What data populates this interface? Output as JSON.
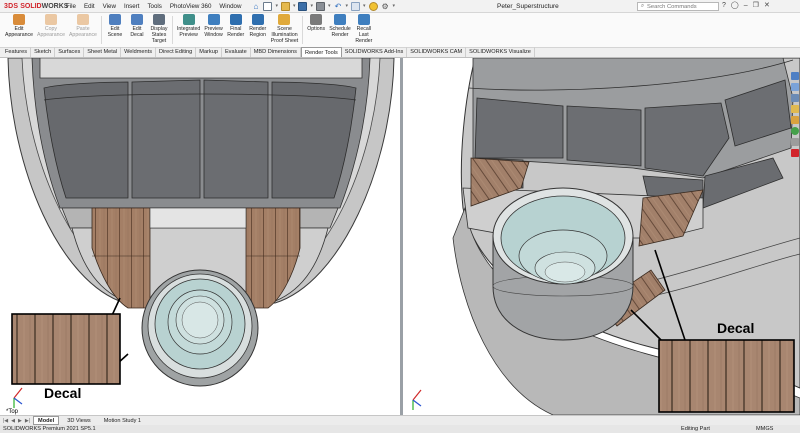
{
  "app": {
    "logo_ds": "3DS",
    "logo_sw": "SOLID",
    "logo_works": "WORKS",
    "document_title": "Peter_Superstructure",
    "menus": [
      "File",
      "Edit",
      "View",
      "Insert",
      "Tools",
      "PhotoView 360",
      "Window"
    ],
    "search_placeholder": "Search Commands"
  },
  "ribbon": {
    "buttons": [
      {
        "label": "Edit\nAppearance",
        "icon": "appearance-icon",
        "disabled": false
      },
      {
        "label": "Copy\nAppearance",
        "icon": "copy-appearance-icon",
        "disabled": true
      },
      {
        "label": "Paste\nAppearance",
        "icon": "paste-appearance-icon",
        "disabled": true
      },
      {
        "label": "Edit\nScene",
        "icon": "scene-icon",
        "disabled": false
      },
      {
        "label": "Edit\nDecal",
        "icon": "decal-icon",
        "disabled": false
      },
      {
        "label": "Display\nStates\nTarget",
        "icon": "display-states-icon",
        "disabled": false
      },
      {
        "label": "Integrated\nPreview",
        "icon": "integrated-preview-icon",
        "disabled": false
      },
      {
        "label": "Preview\nWindow",
        "icon": "preview-window-icon",
        "disabled": false
      },
      {
        "label": "Final\nRender",
        "icon": "final-render-icon",
        "disabled": false
      },
      {
        "label": "Render\nRegion",
        "icon": "render-region-icon",
        "disabled": false
      },
      {
        "label": "Scene\nIllumination\nProof Sheet",
        "icon": "illumination-icon",
        "disabled": false
      },
      {
        "label": "Options",
        "icon": "options-icon",
        "disabled": false
      },
      {
        "label": "Schedule\nRender",
        "icon": "schedule-icon",
        "disabled": false
      },
      {
        "label": "Recall\nLast\nRender",
        "icon": "recall-icon",
        "disabled": false
      }
    ]
  },
  "tabs": [
    {
      "label": "Features",
      "active": false
    },
    {
      "label": "Sketch",
      "active": false
    },
    {
      "label": "Surfaces",
      "active": false
    },
    {
      "label": "Sheet Metal",
      "active": false
    },
    {
      "label": "Weldments",
      "active": false
    },
    {
      "label": "Direct Editing",
      "active": false
    },
    {
      "label": "Markup",
      "active": false
    },
    {
      "label": "Evaluate",
      "active": false
    },
    {
      "label": "MBD Dimensions",
      "active": false
    },
    {
      "label": "Render Tools",
      "active": true
    },
    {
      "label": "SOLIDWORKS Add-Ins",
      "active": false
    },
    {
      "label": "SOLIDWORKS CAM",
      "active": false
    },
    {
      "label": "SOLIDWORKS Visualize",
      "active": false
    }
  ],
  "viewports": {
    "left_callout": "Decal",
    "right_callout": "Decal",
    "left_view_name": "*Top"
  },
  "bottom_tabs": [
    {
      "label": "Model",
      "active": true
    },
    {
      "label": "3D Views",
      "active": false
    },
    {
      "label": "Motion Study 1",
      "active": false
    }
  ],
  "status": {
    "product": "SOLIDWORKS Premium 2021 SP5.1",
    "mode": "Editing Part",
    "units": "MMGS"
  },
  "colors": {
    "accent": "#d1232a",
    "hull": "#c9c9c9",
    "window": "#6b6e72",
    "deck_wood": "#9d7b63",
    "teal": "#b6d3d1"
  }
}
